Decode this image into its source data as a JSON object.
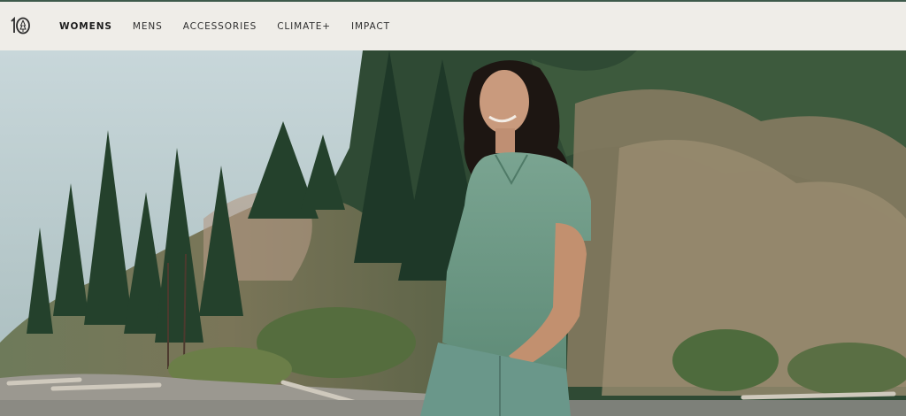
{
  "brand": {
    "logo_text": "10",
    "logo_icon": "tree-logo-icon"
  },
  "nav": {
    "items": [
      {
        "label": "WOMENS",
        "active": true
      },
      {
        "label": "MENS",
        "active": false
      },
      {
        "label": "ACCESSORIES",
        "active": false
      },
      {
        "label": "CLIMATE+",
        "active": false
      },
      {
        "label": "IMPACT",
        "active": false
      }
    ]
  },
  "hero": {
    "image_subject": "hero-photo-woman-on-beach",
    "colors": {
      "sky": "#c4d3d6",
      "forest_dark": "#1f3b2c",
      "forest_mid": "#4f6a46",
      "shirt": "#6f9a86",
      "sand": "#8c8a82"
    }
  }
}
